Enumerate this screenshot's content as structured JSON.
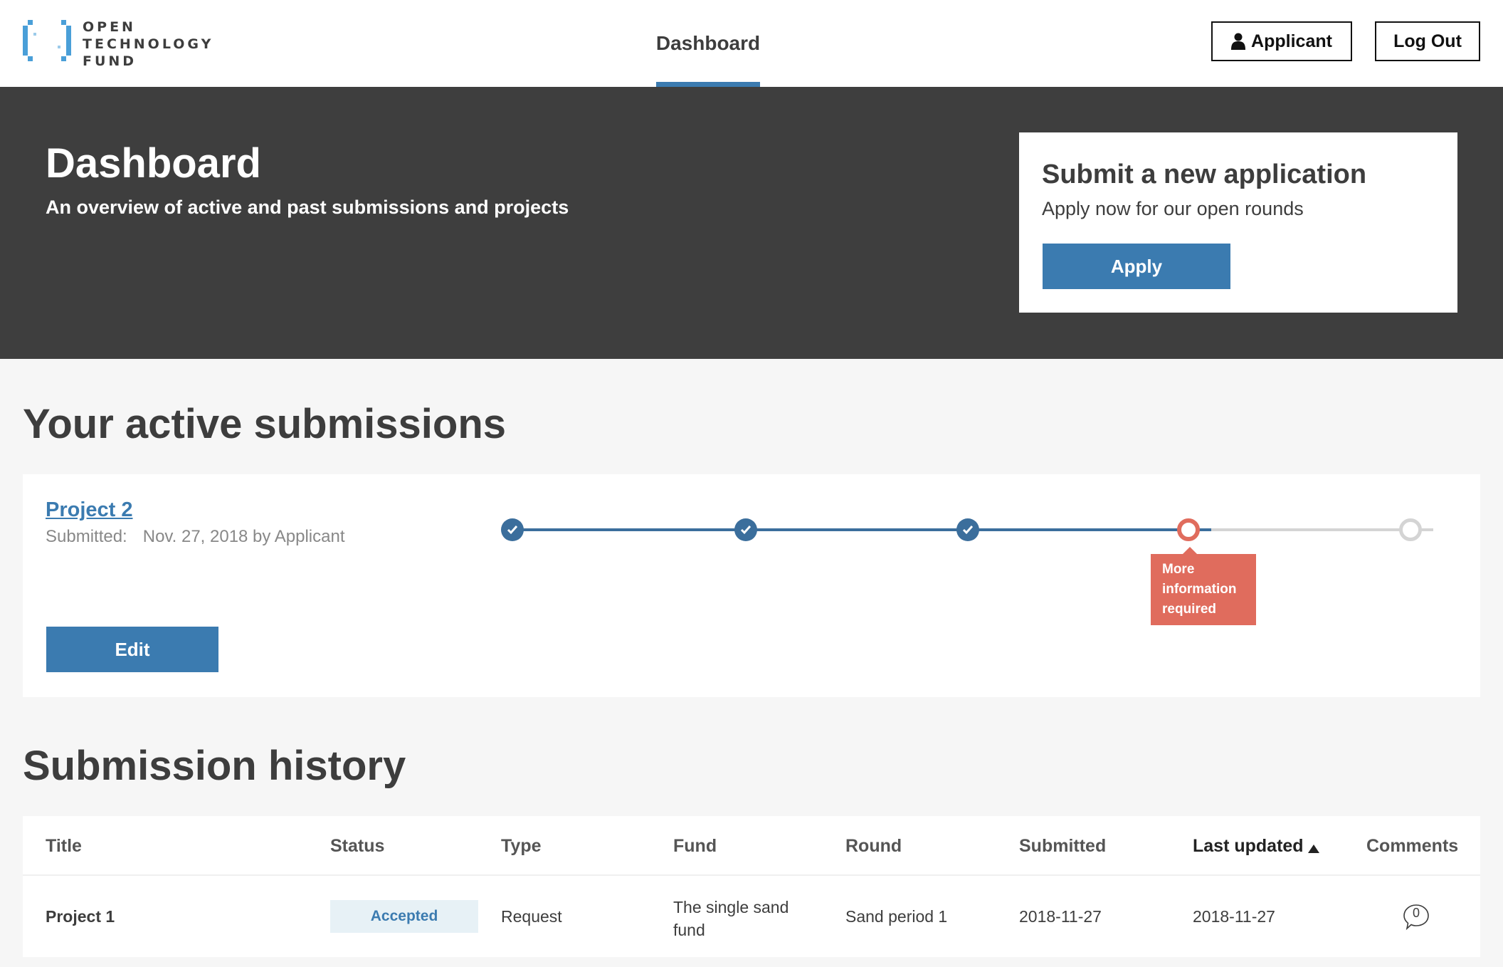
{
  "header": {
    "logo_lines": [
      "OPEN",
      "TECHNOLOGY",
      "FUND"
    ],
    "nav_tab": "Dashboard",
    "applicant_label": "Applicant",
    "logout_label": "Log Out"
  },
  "hero": {
    "title": "Dashboard",
    "subtitle": "An overview of active and past submissions and projects",
    "apply_card": {
      "title": "Submit a new application",
      "subtitle": "Apply now for our open rounds",
      "button": "Apply"
    }
  },
  "active": {
    "title": "Your active submissions",
    "submission": {
      "name": "Project 2",
      "submitted_label": "Submitted:",
      "submitted_value": "Nov. 27, 2018 by Applicant",
      "edit_label": "Edit",
      "steps": [
        "done",
        "done",
        "done",
        "current",
        "todo"
      ],
      "current_step_label": "More information required"
    }
  },
  "history": {
    "title": "Submission history",
    "columns": [
      "Title",
      "Status",
      "Type",
      "Fund",
      "Round",
      "Submitted",
      "Last updated",
      "Comments"
    ],
    "sorted_column": "Last updated",
    "rows": [
      {
        "title": "Project 1",
        "status": "Accepted",
        "type": "Request",
        "fund": "The single sand fund",
        "round": "Sand period 1",
        "submitted": "2018-11-27",
        "last_updated": "2018-11-27",
        "comments": "0"
      }
    ]
  },
  "colors": {
    "primary": "#3b7bb0",
    "hero_bg": "#3e3e3e",
    "alert": "#e06c5d",
    "page_bg": "#f6f6f6"
  },
  "icons": {
    "logo": "otf-bracket-logo",
    "applicant": "user-icon",
    "step_done": "check-icon",
    "comments": "speech-bubble-icon",
    "sort": "sort-ascending-icon"
  }
}
